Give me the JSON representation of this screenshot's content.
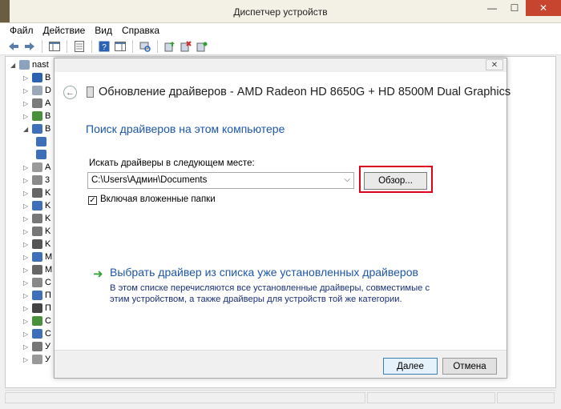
{
  "window": {
    "title": "Диспетчер устройств",
    "minimize_glyph": "—",
    "maximize_glyph": "☐",
    "close_glyph": "✕"
  },
  "menu": [
    "Файл",
    "Действие",
    "Вид",
    "Справка"
  ],
  "tree": {
    "root_label": "nast",
    "rows": [
      "B",
      "D",
      "A",
      "B",
      "B",
      "",
      "",
      "A",
      "3",
      "K",
      "K",
      "K",
      "K",
      "K",
      "M",
      "M",
      "C",
      "П",
      "П",
      "C",
      "C",
      "У",
      "У"
    ]
  },
  "dialog": {
    "title": "Обновление драйверов - AMD Radeon HD 8650G + HD 8500M Dual Graphics",
    "section_title": "Поиск драйверов на этом компьютере",
    "field_label": "Искать драйверы в следующем месте:",
    "path_value": "C:\\Users\\Админ\\Documents",
    "browse_label": "Обзор...",
    "include_subfolders_label": "Включая вложенные папки",
    "include_subfolders_checked": true,
    "choose_link": "Выбрать драйвер из списка уже установленных драйверов",
    "choose_desc": "В этом списке перечисляются все установленные драйверы, совместимые с этим устройством, а также драйверы для устройств той же категории.",
    "next_label": "Далее",
    "cancel_label": "Отмена",
    "close_glyph": "✕"
  },
  "colors": {
    "link_blue": "#1d56a8",
    "highlight_red": "#e0001a",
    "arrow_green": "#2fa12f"
  }
}
